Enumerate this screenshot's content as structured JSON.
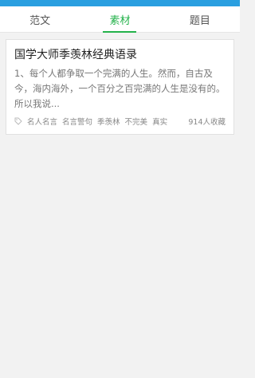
{
  "tabs": [
    {
      "label": "范文"
    },
    {
      "label": "素材"
    },
    {
      "label": "题目"
    }
  ],
  "card": {
    "title": "国学大师季羡林经典语录",
    "excerpt": "1、每个人都争取一个完满的人生。然而，自古及今，海内海外，一个百分之百完满的人生是没有的。所以我说...",
    "tags": [
      "名人名言",
      "名言警句",
      "季羡林",
      "不完美",
      "真实"
    ],
    "count": "914人收藏"
  },
  "colors": {
    "status_bar": "#2a9fe0",
    "active_tab": "#24b24b",
    "background": "#f2f2f2"
  }
}
